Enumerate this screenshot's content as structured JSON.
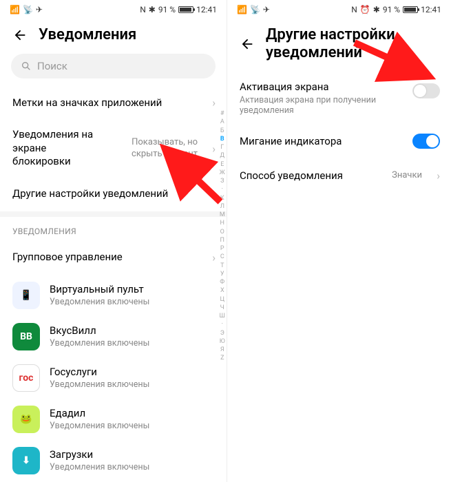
{
  "status": {
    "battery_pct": "91 %",
    "time": "12:41",
    "nfc": "N",
    "bt": "✱",
    "alarm": "⏰"
  },
  "left": {
    "title": "Уведомления",
    "search_placeholder": "Поиск",
    "rows": {
      "badges": {
        "label": "Метки на значках приложений"
      },
      "lockscreen": {
        "label": "Уведомления на экране блокировки",
        "value": "Показывать, но скрыть контент"
      },
      "more": {
        "label": "Другие настройки уведомлений"
      }
    },
    "section_title": "УВЕДОМЛЕНИЯ",
    "group_mgmt": "Групповое управление",
    "apps": [
      {
        "name": "Виртуальный пульт",
        "sub": "Уведомления включены",
        "bg": "#eef3ff",
        "fg": "#2b6fff",
        "glyph": "📱"
      },
      {
        "name": "ВкусВилл",
        "sub": "Уведомления включены",
        "bg": "#0f8a3c",
        "fg": "#ffffff",
        "glyph": "ВВ"
      },
      {
        "name": "Госуслуги",
        "sub": "Уведомления включены",
        "bg": "#ffffff",
        "fg": "#d33",
        "glyph": "гос"
      },
      {
        "name": "Едадил",
        "sub": "Уведомления включены",
        "bg": "#c9f05b",
        "fg": "#2a7a1a",
        "glyph": "🐸"
      },
      {
        "name": "Загрузки",
        "sub": "Уведомления включены",
        "bg": "#1eb6c8",
        "fg": "#ffffff",
        "glyph": "⬇"
      }
    ],
    "index": [
      "#",
      "А",
      "Б",
      "В",
      "Г",
      "Д",
      "Е",
      "Ж",
      "З",
      "·",
      "К",
      "Л",
      "М",
      "Н",
      "О",
      "П",
      "Р",
      "С",
      "Т",
      "У",
      "Ф",
      "Х",
      "Ц",
      "Ч",
      "Ш",
      "·",
      "Э",
      "Ю",
      "Я",
      "Z"
    ],
    "index_highlight": "В"
  },
  "right": {
    "title": "Другие настройки уведомлений",
    "rows": {
      "wake": {
        "label": "Активация экрана",
        "sub": "Активация экрана при получении уведомления",
        "on": false
      },
      "led": {
        "label": "Мигание индикатора",
        "on": true
      },
      "mode": {
        "label": "Способ уведомления",
        "value": "Значки"
      }
    }
  }
}
